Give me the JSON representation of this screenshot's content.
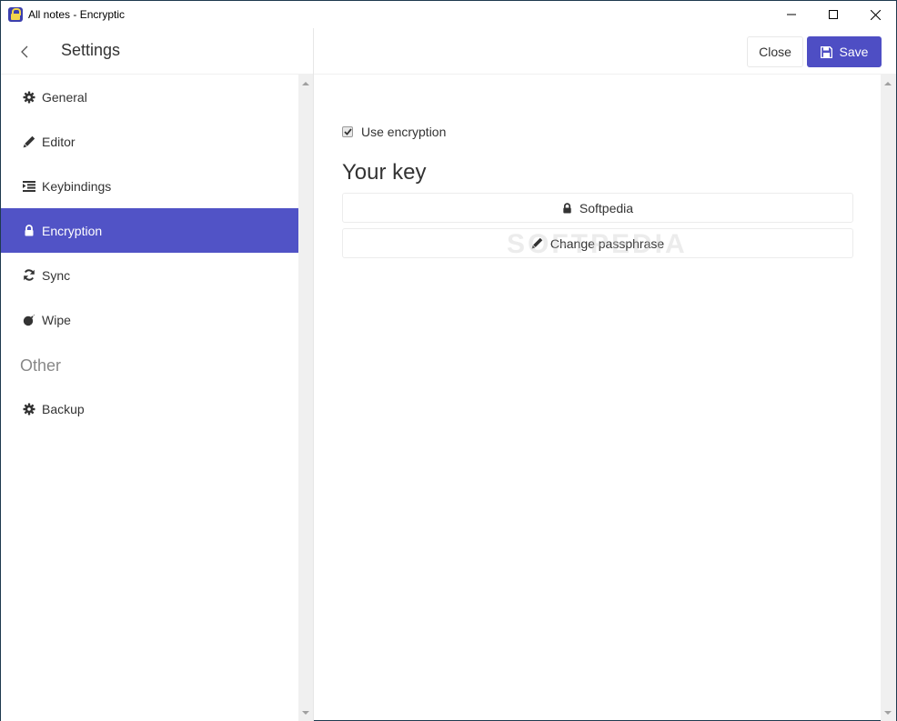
{
  "window": {
    "title": "All notes - Encryptic",
    "controls": [
      "minimize",
      "maximize",
      "close"
    ]
  },
  "sidebar": {
    "title": "Settings",
    "back_icon": "chevron-left-icon",
    "items": [
      {
        "label": "General",
        "icon": "gear-icon",
        "active": false
      },
      {
        "label": "Editor",
        "icon": "pencil-icon",
        "active": false
      },
      {
        "label": "Keybindings",
        "icon": "indent-icon",
        "active": false
      },
      {
        "label": "Encryption",
        "icon": "lock-icon",
        "active": true
      },
      {
        "label": "Sync",
        "icon": "refresh-icon",
        "active": false
      },
      {
        "label": "Wipe",
        "icon": "bomb-icon",
        "active": false
      }
    ],
    "section_other": "Other",
    "other_items": [
      {
        "label": "Backup",
        "icon": "gear-icon",
        "active": false
      }
    ]
  },
  "toolbar": {
    "close_label": "Close",
    "save_label": "Save"
  },
  "encryption": {
    "use_encryption_label": "Use encryption",
    "use_encryption_checked": true,
    "key_heading": "Your key",
    "key_name": "Softpedia",
    "change_passphrase_label": "Change passphrase"
  },
  "watermark": "SOFTPEDIA",
  "colors": {
    "accent": "#5153c6",
    "save_button": "#4e4ec4"
  }
}
